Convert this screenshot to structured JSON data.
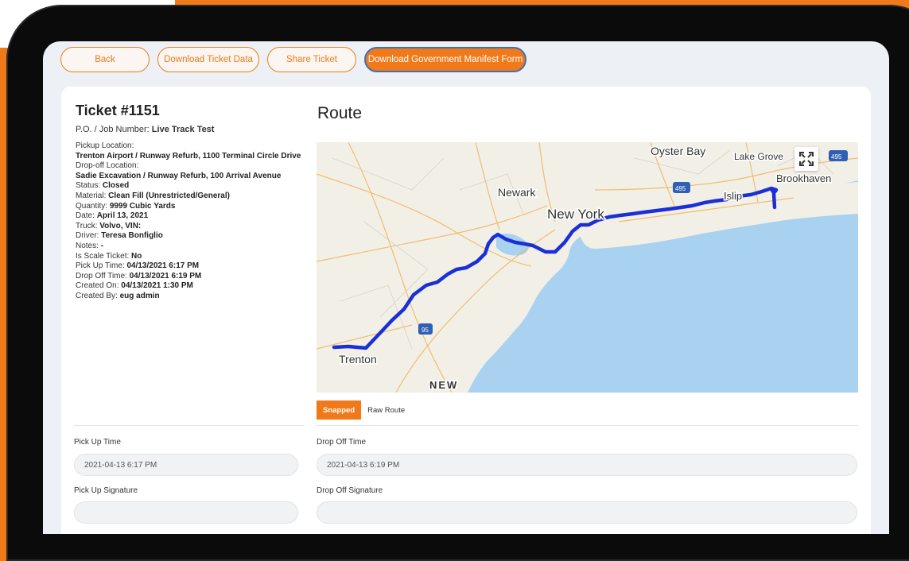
{
  "toolbar": {
    "back": "Back",
    "download_data": "Download Ticket Data",
    "share": "Share Ticket",
    "manifest": "Download Government Manifest Form"
  },
  "ticket": {
    "title": "Ticket #1151",
    "job_label": "P.O. / Job Number:",
    "job_value": "Live Track Test",
    "pickup_label": "Pickup Location:",
    "pickup_value": "Trenton Airport / Runway Refurb, 1100 Terminal Circle Drive",
    "dropoff_label": "Drop-off Location:",
    "dropoff_value": "Sadie Excavation / Runway Refurb, 100 Arrival Avenue",
    "status_label": "Status:",
    "status_value": "Closed",
    "material_label": "Material:",
    "material_value": "Clean Fill (Unrestricted/General)",
    "quantity_label": "Quantity:",
    "quantity_value": "9999 Cubic Yards",
    "date_label": "Date:",
    "date_value": "April 13, 2021",
    "truck_label": "Truck:",
    "truck_value": "Volvo, VIN:",
    "driver_label": "Driver:",
    "driver_value": "Teresa Bonfiglio",
    "notes_label": "Notes:",
    "notes_value": "-",
    "scale_label": "Is Scale Ticket:",
    "scale_value": "No",
    "pickup_time_label": "Pick Up Time:",
    "pickup_time_value": "04/13/2021 6:17 PM",
    "dropoff_time_label": "Drop Off Time:",
    "dropoff_time_value": "04/13/2021 6:19 PM",
    "created_on_label": "Created On:",
    "created_on_value": "04/13/2021 1:30 PM",
    "created_by_label": "Created By:",
    "created_by_value": "eug admin"
  },
  "route": {
    "title": "Route",
    "map_labels": {
      "oyster_bay": "Oyster Bay",
      "lake_grove": "Lake Grove",
      "brookhaven": "Brookhaven",
      "newark": "Newark",
      "new_york": "New York",
      "islip": "Islip",
      "trenton": "Trenton",
      "new": "NEW",
      "shield_495": "495",
      "shield_95": "95",
      "shield_498": "495"
    },
    "route_color": "#1a2fd6",
    "tabs": [
      "Snapped",
      "Raw Route"
    ]
  },
  "fields": {
    "pickup_time_label": "Pick Up Time",
    "pickup_time_value": "2021-04-13 6:17 PM",
    "dropoff_time_label": "Drop Off Time",
    "dropoff_time_value": "2021-04-13 6:19 PM",
    "pickup_signature_label": "Pick Up Signature",
    "dropoff_signature_label": "Drop Off Signature"
  },
  "colors": {
    "accent": "#f07a1a",
    "focus_ring": "#3d6fb8",
    "water": "#a8d2f0",
    "land": "#f2efe6"
  }
}
